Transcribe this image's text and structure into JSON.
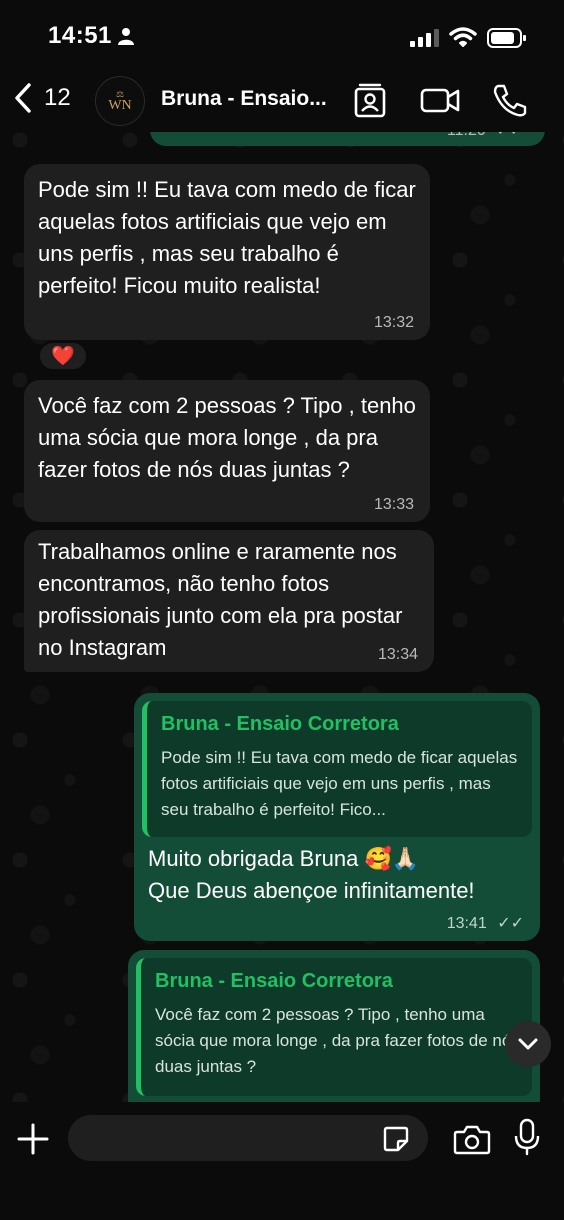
{
  "status_bar": {
    "time": "14:51"
  },
  "header": {
    "back_count": "12",
    "avatar_logo": "WN",
    "contact_name": "Bruna - Ensaio..."
  },
  "messages": [
    {
      "text": "Pode sim !!  Eu tava com medo de ficar aquelas fotos artificiais que vejo em uns perfis , mas seu trabalho é perfeito! Ficou muito realista!",
      "time": "13:32",
      "reaction": "❤️"
    },
    {
      "text": "Você faz com 2 pessoas ? Tipo , tenho uma sócia que mora longe , da pra fazer fotos de nós duas juntas ?",
      "time": "13:33"
    },
    {
      "text": "Trabalhamos online e raramente nos encontramos, não tenho fotos profissionais junto com ela pra postar no Instagram",
      "time": "13:34"
    },
    {
      "quote_name": "Bruna - Ensaio Corretora",
      "quote_text": "Pode sim !!  Eu tava com medo de ficar aquelas fotos artificiais que vejo em uns perfis , mas seu trabalho é perfeito! Fico...",
      "text_line1": "Muito obrigada Bruna 🥰🙏🏻",
      "text_line2": "Que Deus abençoe infinitamente!",
      "time": "13:41"
    },
    {
      "quote_name": "Bruna - Ensaio Corretora",
      "quote_text": "Você faz com 2 pessoas ? Tipo , tenho uma sócia que mora longe , da pra fazer fotos de nós duas juntas ?"
    }
  ],
  "input": {
    "placeholder": ""
  },
  "colors": {
    "incoming_bubble": "#1f1f1f",
    "outgoing_bubble": "#134d37",
    "quote_accent": "#21c063",
    "background": "#0b0b0b"
  },
  "icons": [
    "back-chevron-icon",
    "contact-card-icon",
    "video-call-icon",
    "phone-icon",
    "plus-icon",
    "sticker-icon",
    "camera-icon",
    "microphone-icon",
    "chevron-down-icon",
    "double-check-icon"
  ]
}
